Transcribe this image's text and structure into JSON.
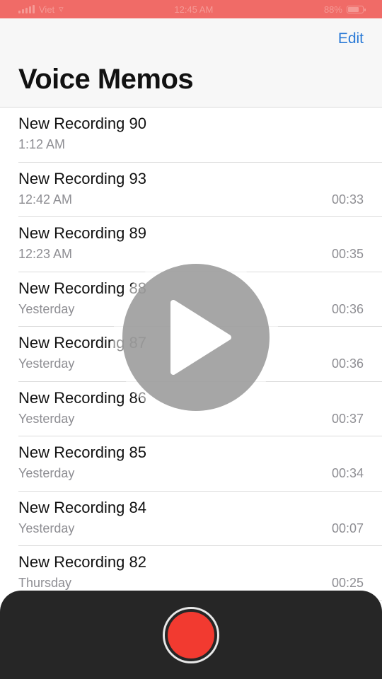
{
  "status_bar": {
    "carrier": "Viet",
    "time": "12:45 AM",
    "battery": "88%"
  },
  "header": {
    "edit_label": "Edit",
    "title": "Voice Memos"
  },
  "recordings": [
    {
      "title": "New Recording 90",
      "date": "1:12 AM",
      "duration": ""
    },
    {
      "title": "New Recording 93",
      "date": "12:42 AM",
      "duration": "00:33"
    },
    {
      "title": "New Recording 89",
      "date": "12:23 AM",
      "duration": "00:35"
    },
    {
      "title": "New Recording 88",
      "date": "Yesterday",
      "duration": "00:36"
    },
    {
      "title": "New Recording 87",
      "date": "Yesterday",
      "duration": "00:36"
    },
    {
      "title": "New Recording 86",
      "date": "Yesterday",
      "duration": "00:37"
    },
    {
      "title": "New Recording 85",
      "date": "Yesterday",
      "duration": "00:34"
    },
    {
      "title": "New Recording 84",
      "date": "Yesterday",
      "duration": "00:07"
    },
    {
      "title": "New Recording 82",
      "date": "Thursday",
      "duration": "00:25"
    }
  ],
  "icons": {
    "play_overlay": "play-icon",
    "record": "record-icon"
  },
  "colors": {
    "status_bar": "#f06b67",
    "accent": "#2a7ad6",
    "record": "#f23a30"
  }
}
